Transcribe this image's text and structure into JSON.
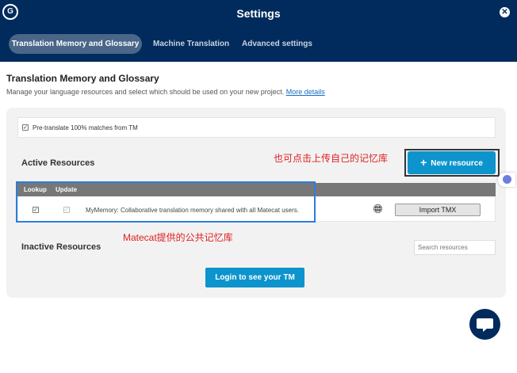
{
  "header": {
    "logo_text": "G",
    "title": "Settings",
    "close_icon": "close-icon",
    "tabs": [
      {
        "label": "Translation Memory and Glossary",
        "active": true
      },
      {
        "label": "Machine Translation",
        "active": false
      },
      {
        "label": "Advanced settings",
        "active": false
      }
    ]
  },
  "main": {
    "heading": "Translation Memory and Glossary",
    "description": "Manage your language resources and select which should be used on your new project.",
    "more_details_link": "More details",
    "pretranslate": {
      "label": "Pre-translate 100% matches from TM",
      "checked": true
    },
    "active_resources": {
      "heading": "Active Resources",
      "new_resource_button": "New resource",
      "columns": [
        "Lookup",
        "Update"
      ],
      "rows": [
        {
          "lookup": true,
          "update": true,
          "description": "MyMemory: Collaborative translation memory shared with all Matecat users.",
          "import_button": "Import TMX"
        }
      ]
    },
    "inactive_resources": {
      "heading": "Inactive Resources",
      "search_placeholder": "Search resources"
    },
    "login_button": "Login to see your TM"
  },
  "annotations": {
    "new_resource_note": "也可点击上传自己的记忆库",
    "mymemory_note": "Matecat提供的公共记忆库"
  },
  "colors": {
    "header_bg": "#002b5c",
    "accent": "#0d94cc",
    "annotation": "#e02020",
    "highlight_frame": "#2a7de1"
  }
}
